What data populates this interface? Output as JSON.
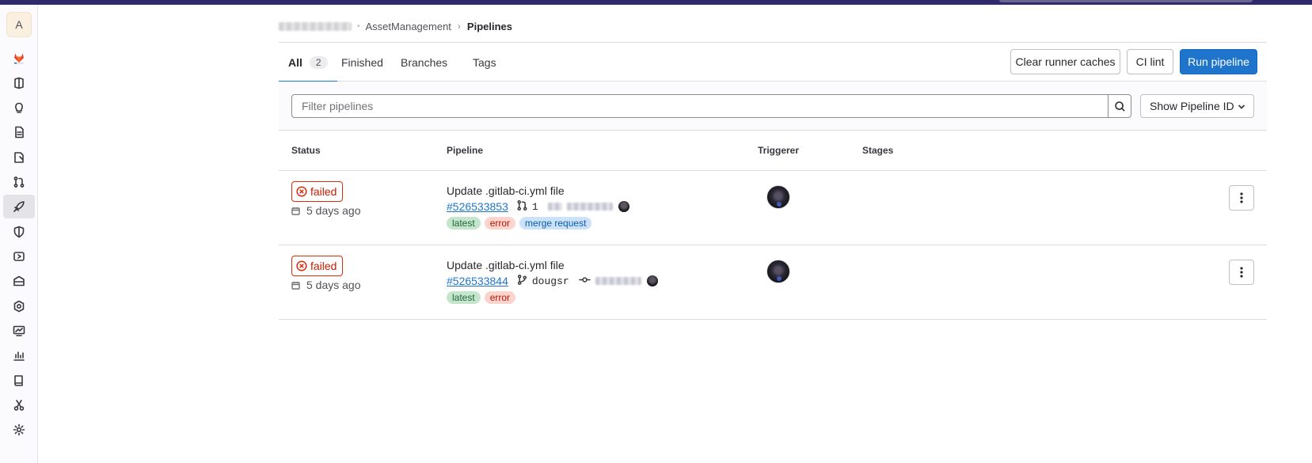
{
  "breadcrumb": {
    "project": "AssetManagement",
    "current": "Pipelines"
  },
  "rail": {
    "avatar_letter": "A"
  },
  "tabs": [
    {
      "label": "All",
      "count": "2"
    },
    {
      "label": "Finished"
    },
    {
      "label": "Branches"
    },
    {
      "label": "Tags"
    }
  ],
  "actions": {
    "clear_caches": "Clear runner caches",
    "ci_lint": "CI lint",
    "run_pipeline": "Run pipeline"
  },
  "filter": {
    "placeholder": "Filter pipelines",
    "show_id": "Show Pipeline ID"
  },
  "table": {
    "headers": {
      "status": "Status",
      "pipeline": "Pipeline",
      "triggerer": "Triggerer",
      "stages": "Stages"
    },
    "rows": [
      {
        "status": "failed",
        "ago": "5 days ago",
        "title": "Update .gitlab-ci.yml file",
        "id": "#526533853",
        "ref": "1",
        "tags": [
          "latest",
          "error",
          "merge request"
        ]
      },
      {
        "status": "failed",
        "ago": "5 days ago",
        "title": "Update .gitlab-ci.yml file",
        "id": "#526533844",
        "ref": "dougsr",
        "tags": [
          "latest",
          "error"
        ]
      }
    ]
  },
  "colors": {
    "accent": "#1f75cb",
    "danger": "#dd2b0e",
    "topbar": "#2f2a6b"
  }
}
